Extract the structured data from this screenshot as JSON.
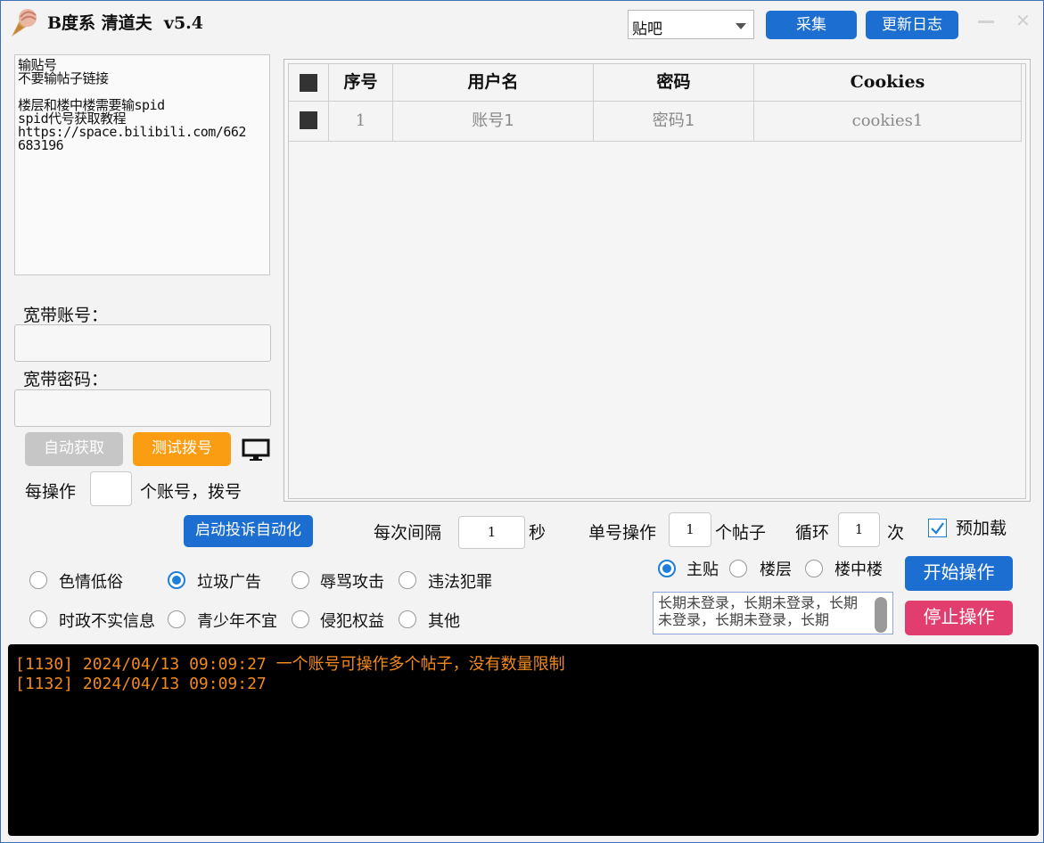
{
  "window": {
    "title": "B度系 清道夫  v5.4"
  },
  "toolbar": {
    "platform_select": "贴吧",
    "collect_label": "采集",
    "changelog_label": "更新日志"
  },
  "notes_lines": [
    "输贴号",
    "不要输帖子链接",
    "",
    "楼层和楼中楼需要输spid",
    "spid代号获取教程",
    "https://space.bilibili.com/662",
    "683196"
  ],
  "broadband": {
    "account_label": "宽带账号：",
    "account_value": "",
    "password_label": "宽带密码：",
    "password_value": "",
    "auto_get_label": "自动获取",
    "test_dial_label": "测试拨号",
    "every_label": "每操作",
    "every_value": "",
    "every_suffix": "个账号，拨号"
  },
  "table": {
    "columns": [
      "序号",
      "用户名",
      "密码",
      "Cookies"
    ],
    "rows": [
      {
        "index": "1",
        "username": "账号1",
        "password": "密码1",
        "cookies": "cookies1"
      }
    ]
  },
  "controls": {
    "auto_complaint_label": "启动投诉自动化",
    "interval_label": "每次间隔",
    "interval_value": "1",
    "interval_unit": "秒",
    "per_account_label": "单号操作",
    "per_account_value": "1",
    "per_account_unit": "个帖子",
    "loop_label": "循环",
    "loop_value": "1",
    "loop_unit": "次",
    "preload_label": "预加载",
    "preload_checked": true
  },
  "reasons": [
    {
      "label": "色情低俗",
      "selected": false
    },
    {
      "label": "垃圾广告",
      "selected": true
    },
    {
      "label": "辱骂攻击",
      "selected": false
    },
    {
      "label": "违法犯罪",
      "selected": false
    },
    {
      "label": "时政不实信息",
      "selected": false
    },
    {
      "label": "青少年不宜",
      "selected": false
    },
    {
      "label": "侵犯权益",
      "selected": false
    },
    {
      "label": "其他",
      "selected": false
    }
  ],
  "targets": [
    {
      "label": "主贴",
      "selected": true
    },
    {
      "label": "楼层",
      "selected": false
    },
    {
      "label": "楼中楼",
      "selected": false
    }
  ],
  "memo_text": "长期未登录，长期未登录，长期未登录，长期未登录，长期",
  "start_label": "开始操作",
  "stop_label": "停止操作",
  "log": [
    {
      "text": "[1130] 2024/04/13 09:09:27 一个账号可操作多个帖子，没有数量限制",
      "color": "#f08a1c"
    },
    {
      "text": "[1132] 2024/04/13 09:09:27",
      "color": "#f08a1c"
    }
  ],
  "colors": {
    "accent": "#1c6fd0",
    "stop": "#e13d6e",
    "orange": "#fb9d12"
  }
}
